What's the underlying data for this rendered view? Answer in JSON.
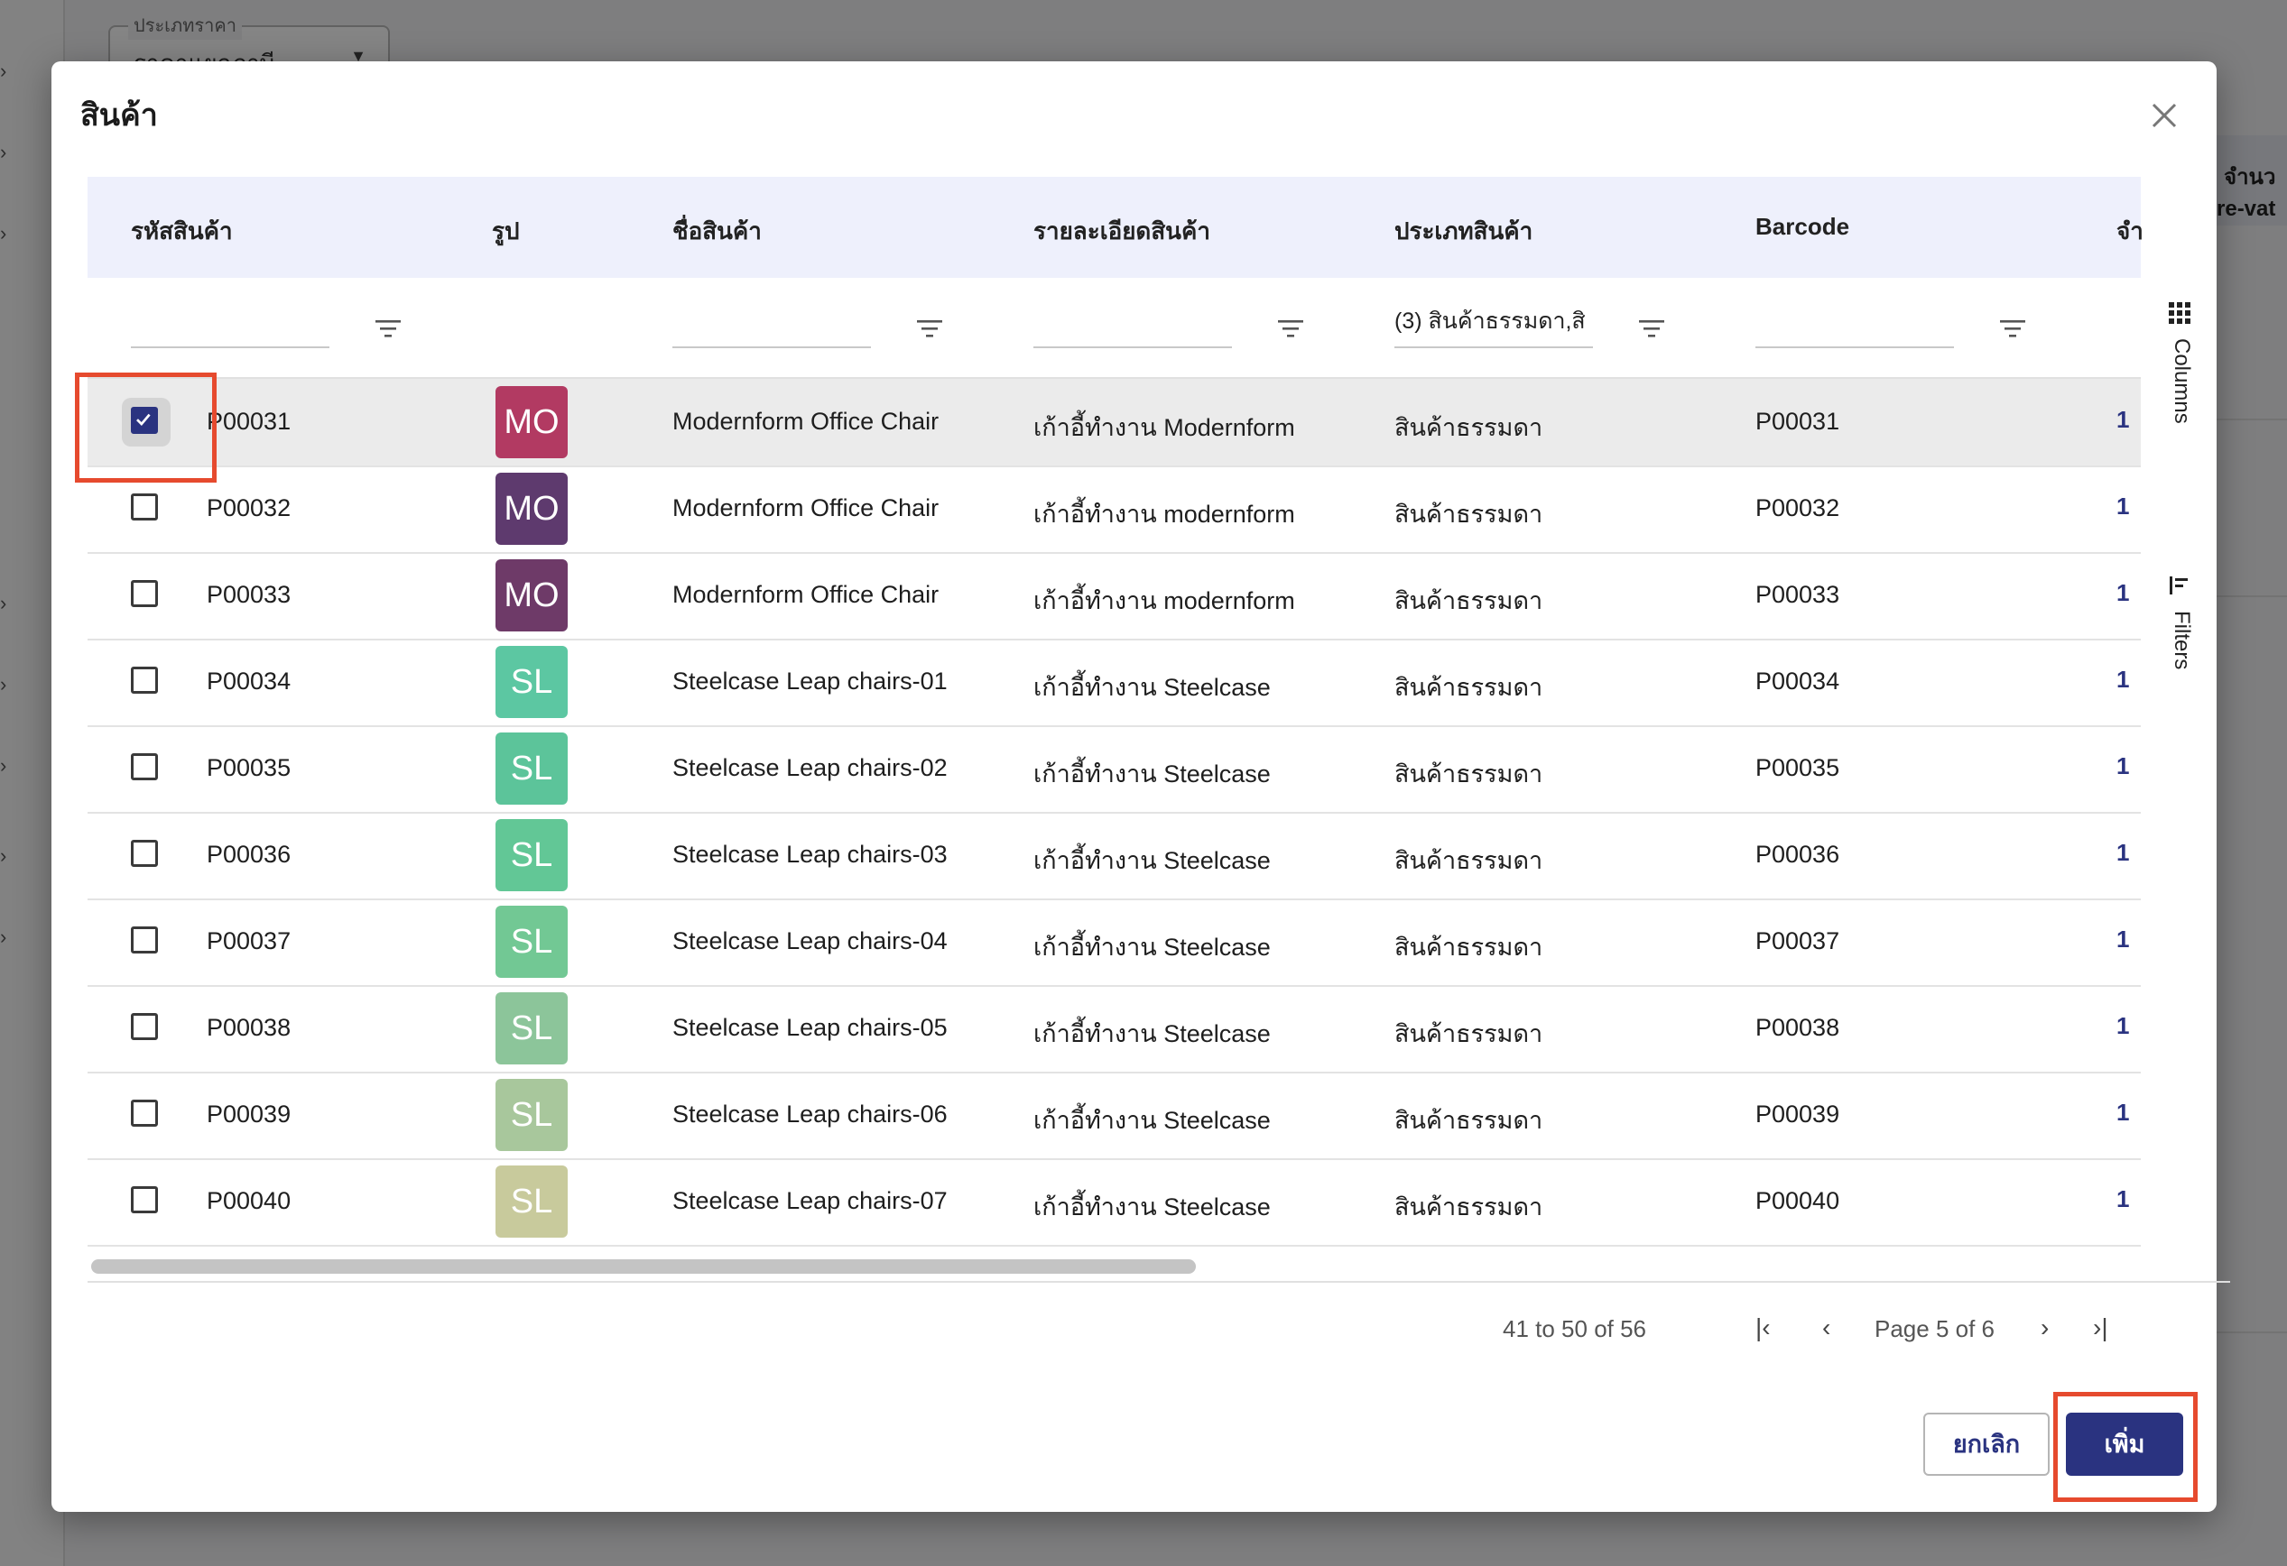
{
  "background": {
    "price_type_legend": "ประเภทราคา",
    "price_type_value": "ราคาแยกภาษี",
    "right_column_header_1": "จำนว",
    "right_column_header_2": "re-vat"
  },
  "modal": {
    "title": "สินค้า",
    "columns": [
      "รหัสสินค้า",
      "รูป",
      "ชื่อสินค้า",
      "รายละเอียดสินค้า",
      "ประเภทสินค้า",
      "Barcode",
      "จำ"
    ],
    "filters": {
      "type_value": "(3) สินค้าธรรมดา,สิ"
    },
    "side_tools": {
      "columns_label": "Columns",
      "filters_label": "Filters"
    },
    "rows": [
      {
        "code": "P00031",
        "avatar": "MO",
        "avatar_color": "#b23a62",
        "name": "Modernform Office Chair",
        "detail": "เก้าอี้ทำงาน Modernform",
        "type": "สินค้าธรรมดา",
        "barcode": "P00031",
        "qty": "1",
        "checked": true
      },
      {
        "code": "P00032",
        "avatar": "MO",
        "avatar_color": "#5e3a6e",
        "name": "Modernform Office Chair",
        "detail": "เก้าอี้ทำงาน modernform",
        "type": "สินค้าธรรมดา",
        "barcode": "P00032",
        "qty": "1",
        "checked": false
      },
      {
        "code": "P00033",
        "avatar": "MO",
        "avatar_color": "#6e3a68",
        "name": "Modernform Office Chair",
        "detail": "เก้าอี้ทำงาน modernform",
        "type": "สินค้าธรรมดา",
        "barcode": "P00033",
        "qty": "1",
        "checked": false
      },
      {
        "code": "P00034",
        "avatar": "SL",
        "avatar_color": "#5cc7a2",
        "name": "Steelcase Leap chairs-01",
        "detail": "เก้าอี้ทำงาน Steelcase",
        "type": "สินค้าธรรมดา",
        "barcode": "P00034",
        "qty": "1",
        "checked": false
      },
      {
        "code": "P00035",
        "avatar": "SL",
        "avatar_color": "#5cc49a",
        "name": "Steelcase Leap chairs-02",
        "detail": "เก้าอี้ทำงาน Steelcase",
        "type": "สินค้าธรรมดา",
        "barcode": "P00035",
        "qty": "1",
        "checked": false
      },
      {
        "code": "P00036",
        "avatar": "SL",
        "avatar_color": "#62c796",
        "name": "Steelcase Leap chairs-03",
        "detail": "เก้าอี้ทำงาน Steelcase",
        "type": "สินค้าธรรมดา",
        "barcode": "P00036",
        "qty": "1",
        "checked": false
      },
      {
        "code": "P00037",
        "avatar": "SL",
        "avatar_color": "#72c894",
        "name": "Steelcase Leap chairs-04",
        "detail": "เก้าอี้ทำงาน Steelcase",
        "type": "สินค้าธรรมดา",
        "barcode": "P00037",
        "qty": "1",
        "checked": false
      },
      {
        "code": "P00038",
        "avatar": "SL",
        "avatar_color": "#8cc59a",
        "name": "Steelcase Leap chairs-05",
        "detail": "เก้าอี้ทำงาน Steelcase",
        "type": "สินค้าธรรมดา",
        "barcode": "P00038",
        "qty": "1",
        "checked": false
      },
      {
        "code": "P00039",
        "avatar": "SL",
        "avatar_color": "#a8c79c",
        "name": "Steelcase Leap chairs-06",
        "detail": "เก้าอี้ทำงาน Steelcase",
        "type": "สินค้าธรรมดา",
        "barcode": "P00039",
        "qty": "1",
        "checked": false
      },
      {
        "code": "P00040",
        "avatar": "SL",
        "avatar_color": "#c8ca9c",
        "name": "Steelcase Leap chairs-07",
        "detail": "เก้าอี้ทำงาน Steelcase",
        "type": "สินค้าธรรมดา",
        "barcode": "P00040",
        "qty": "1",
        "checked": false
      }
    ],
    "pagination": {
      "range": "41 to 50 of 56",
      "page": "Page 5 of 6"
    },
    "buttons": {
      "cancel": "ยกเลิก",
      "add": "เพิ่ม"
    }
  },
  "colors": {
    "accent": "#2a3380",
    "header_bg": "#eef0fc",
    "highlight": "#e64a2e"
  }
}
